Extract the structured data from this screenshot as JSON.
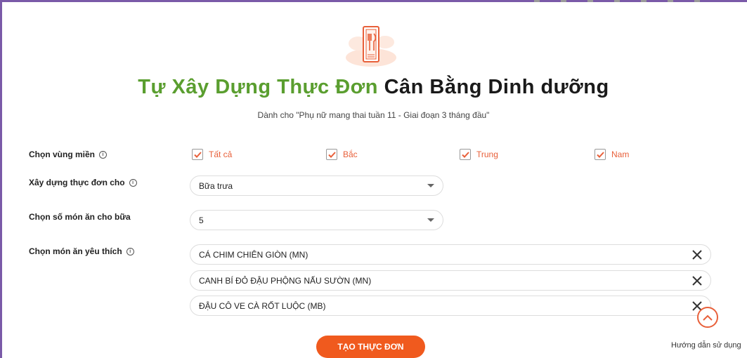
{
  "colors": {
    "accent_green": "#5a9e2f",
    "accent_orange": "#e8603a",
    "button_orange": "#f05a1e",
    "frame_purple": "#7a5aa8"
  },
  "header": {
    "title_green": "Tự Xây Dựng Thực Đơn",
    "title_dark": "Cân Bằng Dinh dưỡng",
    "subtitle": "Dành cho \"Phụ nữ mang thai tuần 11 - Giai đoạn 3 tháng đầu\""
  },
  "form": {
    "region": {
      "label": "Chọn vùng miền",
      "options": [
        {
          "label": "Tất cả",
          "checked": true
        },
        {
          "label": "Bắc",
          "checked": true
        },
        {
          "label": "Trung",
          "checked": true
        },
        {
          "label": "Nam",
          "checked": true
        }
      ]
    },
    "meal": {
      "label": "Xây dựng thực đơn cho",
      "value": "Bữa trưa"
    },
    "dish_count": {
      "label": "Chọn số món ăn cho bữa",
      "value": "5"
    },
    "favorites": {
      "label": "Chọn món ăn yêu thích",
      "items": [
        "CÁ CHIM CHIÊN GIÒN (MN)",
        "CANH BÍ ĐỎ ĐẬU PHỘNG NẤU SƯỜN (MN)",
        "ĐẬU CÔ VE CÀ RỐT LUỘC (MB)"
      ]
    }
  },
  "actions": {
    "create_label": "TẠO THỰC ĐƠN",
    "guide_label": "Hướng dẫn sử dụng"
  },
  "icons": {
    "logo": "menu-book-icon",
    "info": "info-icon",
    "remove": "close-icon",
    "scroll_top": "chevron-up-icon",
    "check": "check-icon"
  }
}
